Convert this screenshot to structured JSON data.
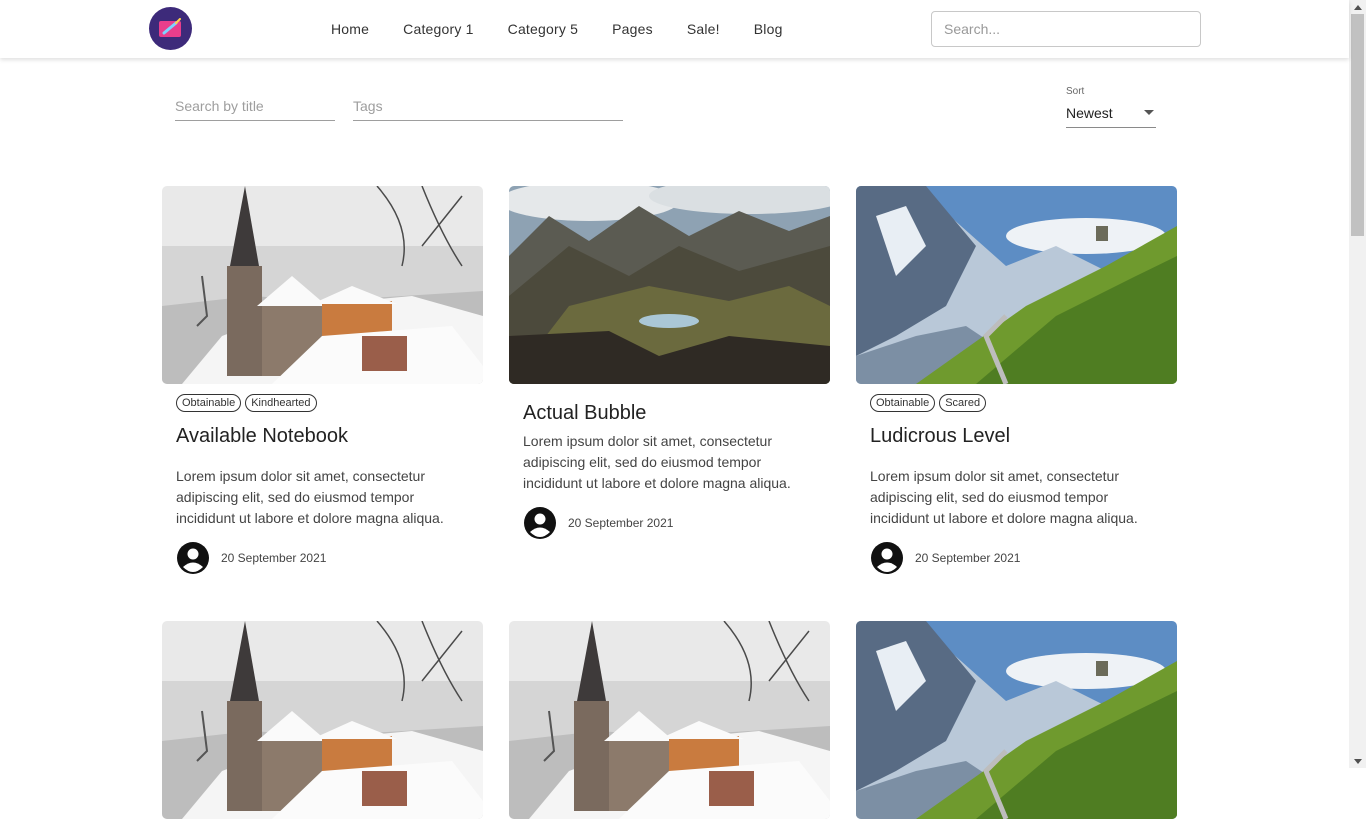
{
  "header": {
    "nav": [
      "Home",
      "Category 1",
      "Category 5",
      "Pages",
      "Sale!",
      "Blog"
    ],
    "search_placeholder": "Search..."
  },
  "filters": {
    "title_placeholder": "Search by title",
    "tags_placeholder": "Tags",
    "sort_label": "Sort",
    "sort_value": "Newest"
  },
  "cards": [
    {
      "image": "winter-church",
      "tags": [
        "Obtainable",
        "Kindhearted"
      ],
      "title": "Available Notebook",
      "text": "Lorem ipsum dolor sit amet, consectetur adipiscing elit, sed do eiusmod tempor incididunt ut labore et dolore magna aliqua.",
      "date": "20 September 2021"
    },
    {
      "image": "mountain-lake",
      "tags": [],
      "title": "Actual Bubble",
      "text": "Lorem ipsum dolor sit amet, consectetur adipiscing elit, sed do eiusmod tempor incididunt ut labore et dolore magna aliqua.",
      "date": "20 September 2021"
    },
    {
      "image": "alpine-road",
      "tags": [
        "Obtainable",
        "Scared"
      ],
      "title": "Ludicrous Level",
      "text": "Lorem ipsum dolor sit amet, consectetur adipiscing elit, sed do eiusmod tempor incididunt ut labore et dolore magna aliqua.",
      "date": "20 September 2021"
    },
    {
      "image": "winter-church"
    },
    {
      "image": "winter-church"
    },
    {
      "image": "alpine-road"
    }
  ],
  "colors": {
    "logo_bg": "#3d2a7a",
    "logo_accent": "#e83e8c"
  }
}
